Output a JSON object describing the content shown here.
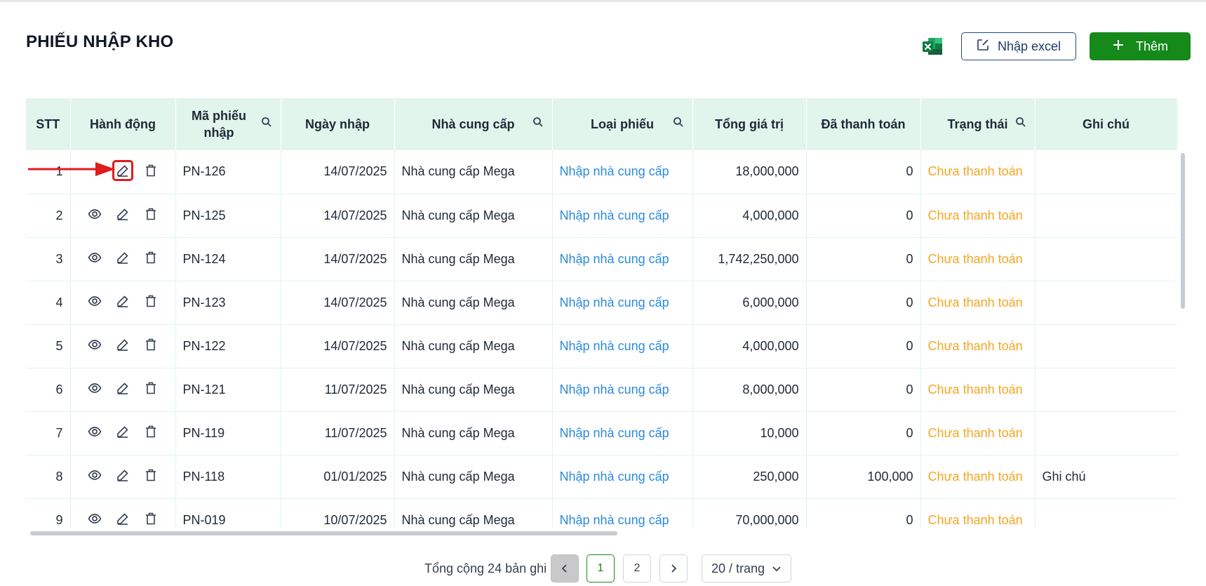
{
  "page": {
    "title": "PHIẾU NHẬP KHO"
  },
  "toolbar": {
    "excel_icon": "excel-icon",
    "import_label": "Nhập excel",
    "add_label": "Thêm"
  },
  "table": {
    "headers": {
      "stt": "STT",
      "actions": "Hành động",
      "code": "Mã phiếu nhập",
      "date": "Ngày nhập",
      "supplier": "Nhà cung cấp",
      "type": "Loại phiếu",
      "total": "Tổng giá trị",
      "paid": "Đã thanh toán",
      "status": "Trạng thái",
      "note": "Ghi chú"
    },
    "rows": [
      {
        "stt": "1",
        "code": "PN-126",
        "date": "14/07/2025",
        "supplier": "Nhà cung cấp Mega",
        "type": "Nhập nhà cung cấp",
        "total": "18,000,000",
        "paid": "0",
        "status": "Chưa thanh toán",
        "note": ""
      },
      {
        "stt": "2",
        "code": "PN-125",
        "date": "14/07/2025",
        "supplier": "Nhà cung cấp Mega",
        "type": "Nhập nhà cung cấp",
        "total": "4,000,000",
        "paid": "0",
        "status": "Chưa thanh toán",
        "note": ""
      },
      {
        "stt": "3",
        "code": "PN-124",
        "date": "14/07/2025",
        "supplier": "Nhà cung cấp Mega",
        "type": "Nhập nhà cung cấp",
        "total": "1,742,250,000",
        "paid": "0",
        "status": "Chưa thanh toán",
        "note": ""
      },
      {
        "stt": "4",
        "code": "PN-123",
        "date": "14/07/2025",
        "supplier": "Nhà cung cấp Mega",
        "type": "Nhập nhà cung cấp",
        "total": "6,000,000",
        "paid": "0",
        "status": "Chưa thanh toán",
        "note": ""
      },
      {
        "stt": "5",
        "code": "PN-122",
        "date": "14/07/2025",
        "supplier": "Nhà cung cấp Mega",
        "type": "Nhập nhà cung cấp",
        "total": "4,000,000",
        "paid": "0",
        "status": "Chưa thanh toán",
        "note": ""
      },
      {
        "stt": "6",
        "code": "PN-121",
        "date": "11/07/2025",
        "supplier": "Nhà cung cấp Mega",
        "type": "Nhập nhà cung cấp",
        "total": "8,000,000",
        "paid": "0",
        "status": "Chưa thanh toán",
        "note": ""
      },
      {
        "stt": "7",
        "code": "PN-119",
        "date": "11/07/2025",
        "supplier": "Nhà cung cấp Mega",
        "type": "Nhập nhà cung cấp",
        "total": "10,000",
        "paid": "0",
        "status": "Chưa thanh toán",
        "note": ""
      },
      {
        "stt": "8",
        "code": "PN-118",
        "date": "01/01/2025",
        "supplier": "Nhà cung cấp Mega",
        "type": "Nhập nhà cung cấp",
        "total": "250,000",
        "paid": "100,000",
        "status": "Chưa thanh toán",
        "note": "Ghi chú"
      },
      {
        "stt": "9",
        "code": "PN-019",
        "date": "10/07/2025",
        "supplier": "Nhà cung cấp Mega",
        "type": "Nhập nhà cung cấp",
        "total": "70,000,000",
        "paid": "0",
        "status": "Chưa thanh toán",
        "note": ""
      }
    ],
    "row_icons": [
      "eye-icon",
      "edit-icon",
      "trash-icon"
    ],
    "colors": {
      "header_bg": "#e2f5ec",
      "link": "#2b8ae0",
      "status_unpaid": "#f5a623"
    }
  },
  "pagination": {
    "total_text": "Tổng cộng 24 bản ghi",
    "pages": [
      "1",
      "2"
    ],
    "current_page": "1",
    "page_size": "20 / trang"
  },
  "colors": {
    "primary_green": "#15891a",
    "import_border": "#1f4e79",
    "annotation_red": "#e01b1b"
  }
}
